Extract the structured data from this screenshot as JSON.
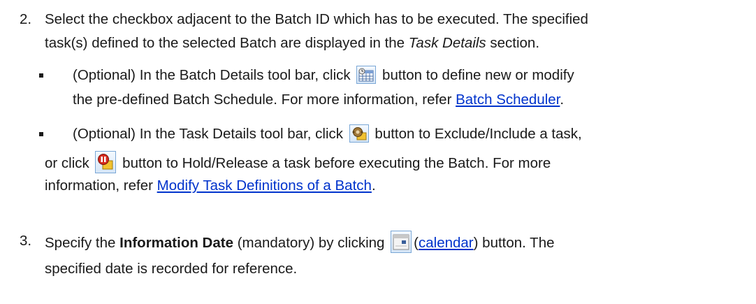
{
  "step2": {
    "number": "2.",
    "line1": "Select the checkbox adjacent to the Batch ID which has to be executed. The specified",
    "line2_pre": "task(s) defined to the selected Batch are displayed in the ",
    "line2_em": "Task Details",
    "line2_post": " section."
  },
  "bullet1": {
    "line1_pre": "(Optional) In the Batch Details tool bar, click ",
    "line1_post": " button to define new or modify",
    "line2_pre": "the pre-defined Batch Schedule. For more information, refer ",
    "link": "Batch Scheduler",
    "line2_post": ".",
    "icon": "batch-schedule-icon"
  },
  "bullet2": {
    "line1_pre": "(Optional) In the Task Details tool bar, click ",
    "line1_post": " button to Exclude/Include a task,",
    "line2_pre": "or click ",
    "line2_post": " button to Hold/Release a task before executing the Batch. For more",
    "line3_pre": "information, refer ",
    "link": "Modify Task Definitions of a Batch",
    "line3_post": ".",
    "icon1": "exclude-include-icon",
    "icon2": "hold-release-icon"
  },
  "step3": {
    "number": "3.",
    "line1_pre": "Specify the ",
    "line1_bold": "Information Date",
    "line1_mid": " (mandatory) by clicking ",
    "paren_open": "(",
    "link": "calendar",
    "paren_close": ")",
    "line1_post": " button. The",
    "line2": "specified date is recorded for reference.",
    "icon": "calendar-icon"
  },
  "colors": {
    "text": "#1a1a1a",
    "link": "#0033cc"
  }
}
